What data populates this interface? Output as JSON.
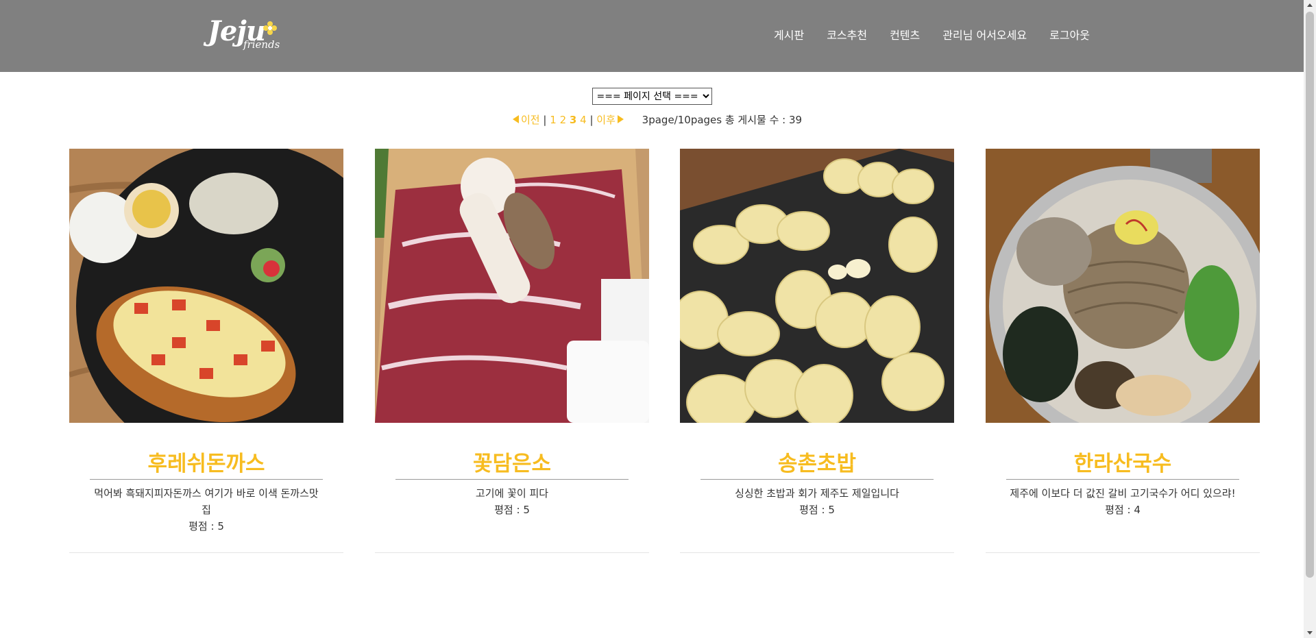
{
  "header": {
    "logo_main": "Jeju",
    "logo_sub": "friends",
    "nav": [
      "게시판",
      "코스추천",
      "컨텐츠",
      "관리님 어서오세요",
      "로그아웃"
    ]
  },
  "page_select": {
    "selected": "=== 페이지 선택 ==="
  },
  "pagination": {
    "prev": "이전",
    "sep": "|",
    "pages": [
      "1",
      "2",
      "3",
      "4"
    ],
    "current": "3",
    "next": "이후",
    "info": "3page/10pages 총 게시물 수 : 39"
  },
  "cards": [
    {
      "title": "후레쉬돈까스",
      "desc": "먹어봐 흑돼지피자돈까스 여기가 바로 이색 돈까스맛집",
      "rating": "평점 : 5"
    },
    {
      "title": "꽃담은소",
      "desc": "고기에 꽃이 피다",
      "rating": "평점 : 5"
    },
    {
      "title": "송촌초밥",
      "desc": "싱싱한 초밥과 회가 제주도 제일입니다",
      "rating": "평점 : 5"
    },
    {
      "title": "한라산국수",
      "desc": "제주에 이보다 더 값진 갈비 고기국수가 어디 있으랴!",
      "rating": "평점 : 4"
    }
  ],
  "colors": {
    "header_bg": "#808080",
    "accent": "#f7bc20",
    "text": "#333333"
  }
}
